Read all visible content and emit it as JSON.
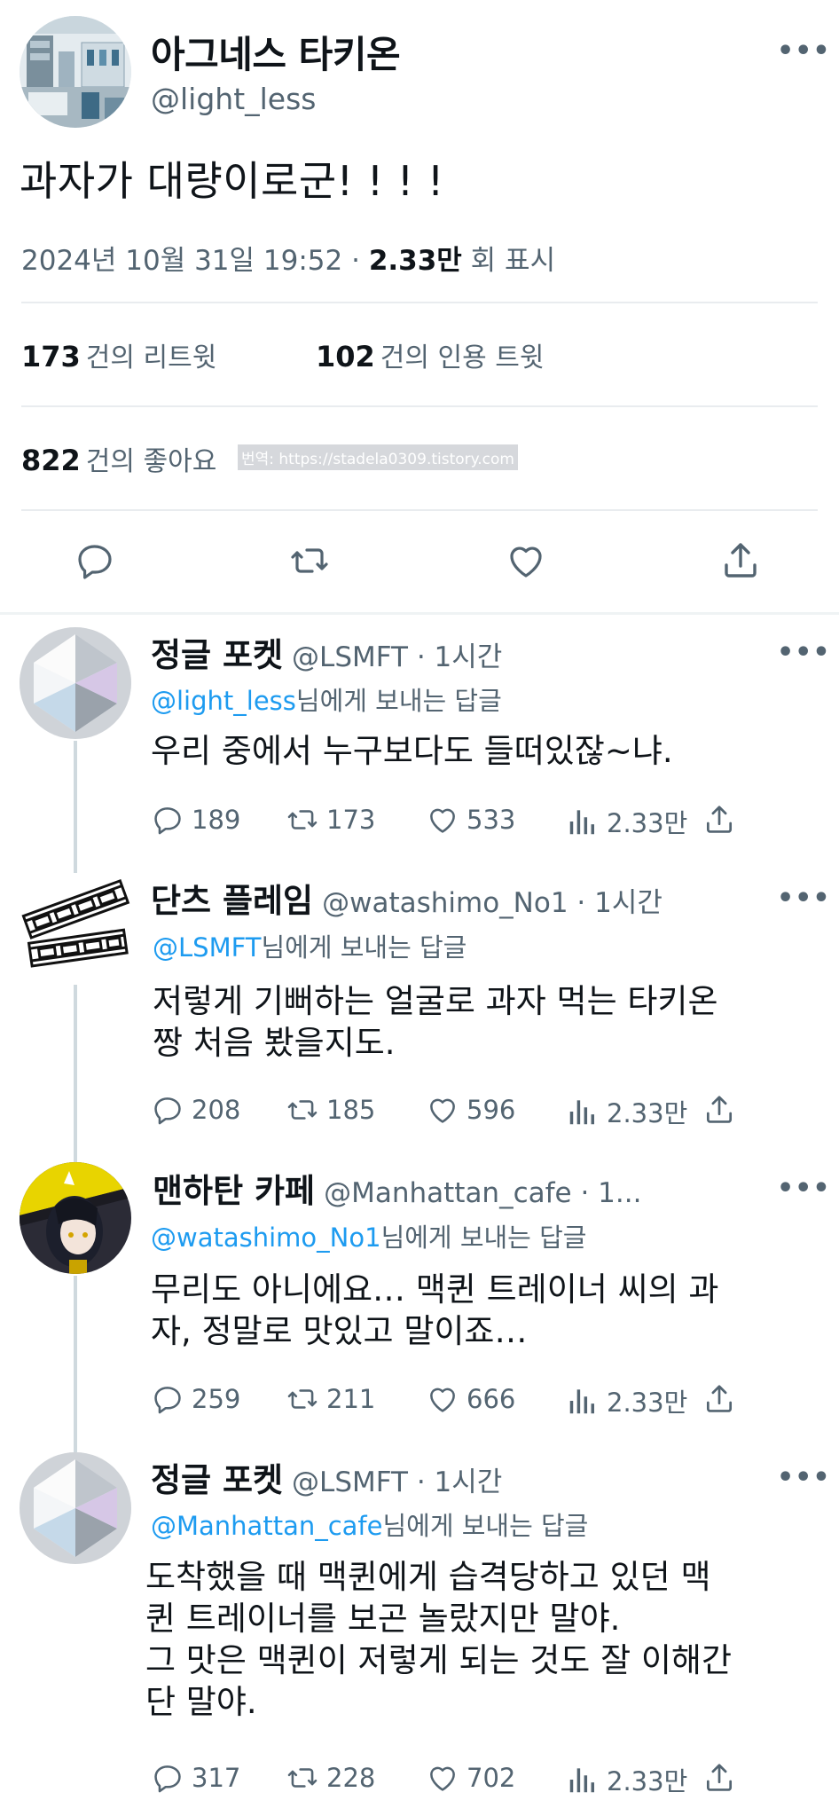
{
  "main_tweet": {
    "name": "아그네스 타키온",
    "handle": "@light_less",
    "text": "과자가 대량이로군! ! ! !",
    "date": "2024년 10월 31일  19:52 · ",
    "views_num": "2.33만",
    "views_label": " 회 표시",
    "retweets_num": "173",
    "retweets_label": "건의 리트윗",
    "quotes_num": "102",
    "quotes_label": "건의 인용 트윗",
    "likes_num": "822",
    "likes_label": "건의 좋아요",
    "watermark": "번역: https://stadela0309.tistory.com"
  },
  "replies": [
    {
      "name": "정글 포켓",
      "handle": "@LSMFT · 1시간",
      "reply_to_handle": "@light_less",
      "reply_to_suffix": "님에게 보내는 답글",
      "text": "우리 중에서 누구보다도 들떠있잖~냐.",
      "replies": "189",
      "retweets": "173",
      "likes": "533",
      "views": "2.33만"
    },
    {
      "name": "단츠 플레임",
      "handle": "@watashimo_No1 · 1시간",
      "reply_to_handle": "@LSMFT",
      "reply_to_suffix": "님에게 보내는 답글",
      "text": "저렇게 기뻐하는 얼굴로 과자 먹는 타키온\n짱 처음 봤을지도.",
      "replies": "208",
      "retweets": "185",
      "likes": "596",
      "views": "2.33만"
    },
    {
      "name": "맨하탄 카페",
      "handle": "@Manhattan_cafe · 1...",
      "reply_to_handle": "@watashimo_No1",
      "reply_to_suffix": "님에게 보내는 답글",
      "text": "무리도 아니에요… 맥퀸 트레이너 씨의 과\n자, 정말로 맛있고 말이죠…",
      "replies": "259",
      "retweets": "211",
      "likes": "666",
      "views": "2.33만"
    },
    {
      "name": "정글 포켓",
      "handle": "@LSMFT · 1시간",
      "reply_to_handle": "@Manhattan_cafe",
      "reply_to_suffix": "님에게 보내는 답글",
      "text": "도착했을 때 맥퀸에게 습격당하고 있던 맥\n퀸 트레이너를 보곤 놀랐지만 말야.\n그 맛은 맥퀸이 저렇게 되는 것도 잘 이해간\n단 말야.",
      "replies": "317",
      "retweets": "228",
      "likes": "702",
      "views": "2.33만"
    }
  ],
  "icons": {
    "more": "more-icon",
    "reply": "reply-icon",
    "retweet": "retweet-icon",
    "like": "heart-icon",
    "share": "share-icon",
    "views": "views-icon"
  },
  "colors": {
    "link": "#1d9bf0",
    "secondary": "#536471",
    "primary_text": "#0f1419"
  }
}
